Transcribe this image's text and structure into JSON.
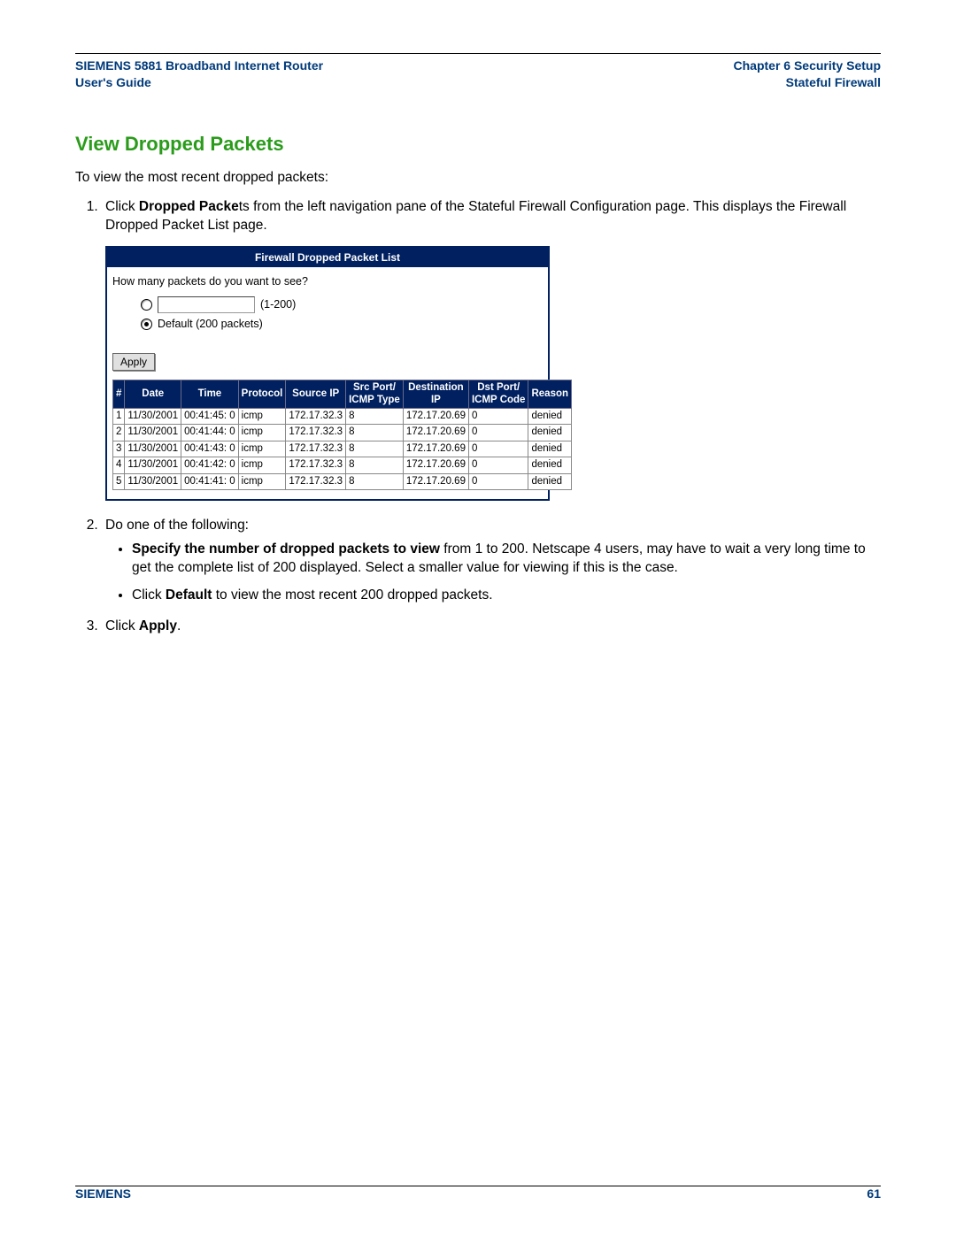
{
  "header": {
    "left_line1": "SIEMENS 5881 Broadband Internet Router",
    "left_line2": "User's Guide",
    "right_line1": "Chapter 6  Security Setup",
    "right_line2": "Stateful Firewall"
  },
  "section_title": "View Dropped Packets",
  "intro": "To view the most recent dropped packets:",
  "step1_a": "Click ",
  "step1_bold": "Dropped Packe",
  "step1_b": "ts from the left navigation pane of the Stateful Firewall Configuration page. This displays the Firewall Dropped Packet List page.",
  "panel": {
    "title": "Firewall Dropped Packet List",
    "prompt": "How many packets do you want to see?",
    "range": "(1-200)",
    "default_label": "Default (200 packets)",
    "apply": "Apply",
    "headers": {
      "num": "#",
      "date": "Date",
      "time": "Time",
      "protocol": "Protocol",
      "src_ip": "Source IP",
      "src_port": "Src Port/\nICMP Type",
      "dst_ip": "Destination IP",
      "dst_port": "Dst Port/\nICMP Code",
      "reason": "Reason"
    },
    "rows": [
      {
        "n": "1",
        "date": "11/30/2001",
        "time": "00:41:45: 0",
        "proto": "icmp",
        "sip": "172.17.32.3",
        "sp": "8",
        "dip": "172.17.20.69",
        "dp": "0",
        "reason": "denied"
      },
      {
        "n": "2",
        "date": "11/30/2001",
        "time": "00:41:44: 0",
        "proto": "icmp",
        "sip": "172.17.32.3",
        "sp": "8",
        "dip": "172.17.20.69",
        "dp": "0",
        "reason": "denied"
      },
      {
        "n": "3",
        "date": "11/30/2001",
        "time": "00:41:43: 0",
        "proto": "icmp",
        "sip": "172.17.32.3",
        "sp": "8",
        "dip": "172.17.20.69",
        "dp": "0",
        "reason": "denied"
      },
      {
        "n": "4",
        "date": "11/30/2001",
        "time": "00:41:42: 0",
        "proto": "icmp",
        "sip": "172.17.32.3",
        "sp": "8",
        "dip": "172.17.20.69",
        "dp": "0",
        "reason": "denied"
      },
      {
        "n": "5",
        "date": "11/30/2001",
        "time": "00:41:41: 0",
        "proto": "icmp",
        "sip": "172.17.32.3",
        "sp": "8",
        "dip": "172.17.20.69",
        "dp": "0",
        "reason": "denied"
      }
    ]
  },
  "step2_intro": "Do one of the following:",
  "step2_b1_bold": "Specify the number of dropped packets to view",
  "step2_b1_rest": " from 1 to 200. Netscape 4 users, may have to wait a very long time to get the complete list of 200 displayed. Select a smaller value for viewing if this is the case.",
  "step2_b2_a": "Click ",
  "step2_b2_bold": "Default",
  "step2_b2_b": " to view the most recent 200 dropped packets.",
  "step3_a": "Click ",
  "step3_bold": "Apply",
  "step3_b": ".",
  "footer": {
    "brand": "SIEMENS",
    "page": "61"
  }
}
